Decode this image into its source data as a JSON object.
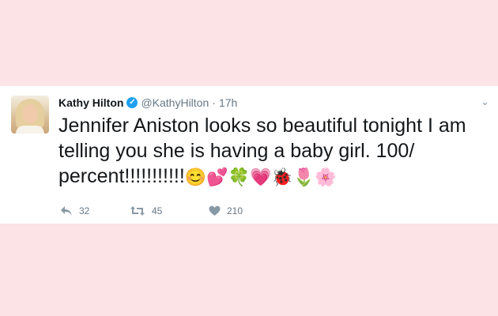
{
  "tweet": {
    "author_name": "Kathy Hilton",
    "handle": "@KathyHilton",
    "separator": "·",
    "time": "17h",
    "verified_glyph": "✓",
    "caret_glyph": "⌄",
    "text": "Jennifer Aniston looks so beautiful tonight I am telling you she is having a baby girl. 100/ percent!!!!!!!!!!!",
    "emojis": "😊💕🍀💗🐞🌷🌸",
    "stats": {
      "replies": "32",
      "retweets": "45",
      "likes": "210"
    }
  },
  "icons": {
    "verified": "verified-badge-icon",
    "caret": "chevron-down-icon",
    "reply": "reply-icon",
    "retweet": "retweet-icon",
    "like": "heart-icon"
  },
  "colors": {
    "background": "#fbe3e6",
    "card": "#ffffff",
    "text": "#14171a",
    "muted": "#657786",
    "verified": "#1da1f2"
  }
}
